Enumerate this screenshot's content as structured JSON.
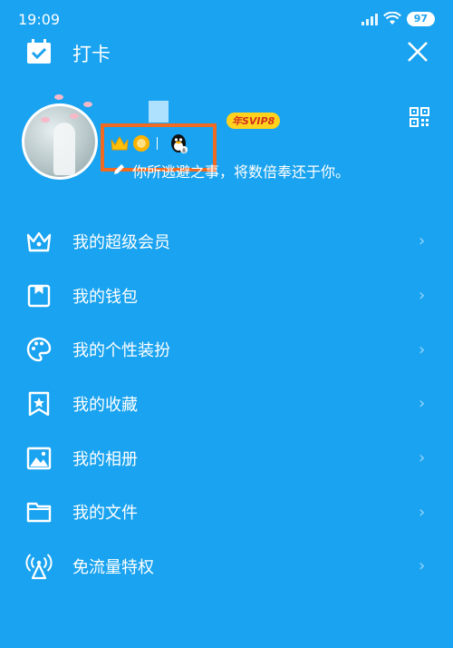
{
  "status_bar": {
    "time": "19:09",
    "battery": "97"
  },
  "header": {
    "checkin_label": "打卡"
  },
  "profile": {
    "svip_badge": "年SVIP8",
    "signature": "你所逃避之事，将数倍奉还于你。"
  },
  "menu": [
    {
      "label": "我的超级会员",
      "icon": "crown-outline-icon"
    },
    {
      "label": "我的钱包",
      "icon": "wallet-icon"
    },
    {
      "label": "我的个性装扮",
      "icon": "palette-icon"
    },
    {
      "label": "我的收藏",
      "icon": "bookmark-star-icon"
    },
    {
      "label": "我的相册",
      "icon": "image-icon"
    },
    {
      "label": "我的文件",
      "icon": "folder-icon"
    },
    {
      "label": "免流量特权",
      "icon": "antenna-icon"
    }
  ],
  "colors": {
    "background": "#1aa3f0",
    "highlight": "#ef6a22",
    "badge": "#ffd21e"
  }
}
